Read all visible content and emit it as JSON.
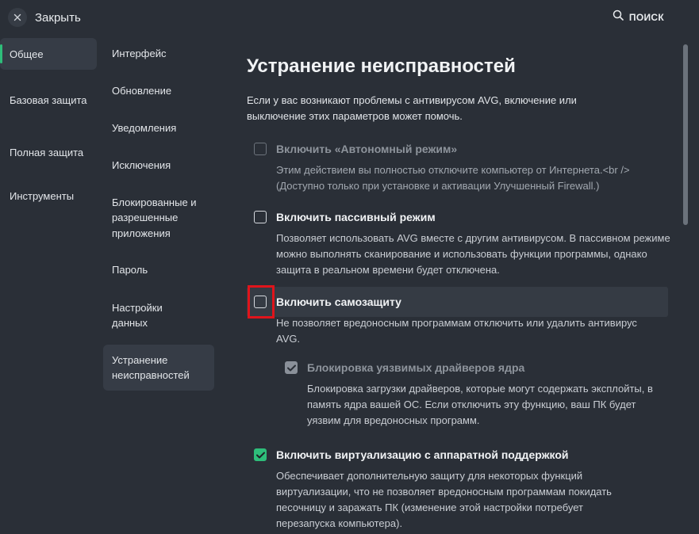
{
  "header": {
    "close_label": "Закрыть",
    "search_label": "ПОИСК"
  },
  "nav_primary": [
    {
      "label": "Общее",
      "active": true
    },
    {
      "label": "Базовая защита",
      "active": false
    },
    {
      "label": "Полная защита",
      "active": false
    },
    {
      "label": "Инструменты",
      "active": false
    }
  ],
  "nav_secondary": [
    {
      "label": "Интерфейс",
      "active": false
    },
    {
      "label": "Обновление",
      "active": false
    },
    {
      "label": "Уведомления",
      "active": false
    },
    {
      "label": "Исключения",
      "active": false
    },
    {
      "label": "Блокированные и разрешенные приложения",
      "active": false
    },
    {
      "label": "Пароль",
      "active": false
    },
    {
      "label": "Настройки данных",
      "active": false
    },
    {
      "label": "Устранение неисправностей",
      "active": true
    }
  ],
  "content": {
    "title": "Устранение неисправностей",
    "intro": "Если у вас возникают проблемы с антивирусом AVG, включение или выключение этих параметров может помочь.",
    "options": [
      {
        "label": "Включить «Автономный режим»",
        "checked": false,
        "disabled": true,
        "description": "Этим действием вы полностью отключите компьютер от Интернета.<br /> (Доступно только при установке и активации Улучшенный Firewall.)"
      },
      {
        "label": "Включить пассивный режим",
        "checked": false,
        "disabled": false,
        "description": "Позволяет использовать AVG вместе с другим антивирусом. В пассивном режиме можно выполнять сканирование и использовать функции программы, однако защита в реальном времени будет отключена."
      },
      {
        "label": "Включить самозащиту",
        "checked": false,
        "disabled": false,
        "description": "Не позволяет вредоносным программам отключить или удалить антивирус AVG."
      },
      {
        "label": "Блокировка уязвимых драйверов ядра",
        "checked": true,
        "disabled": true,
        "description": "Блокировка загрузки драйверов, которые могут содержать эксплойты, в память ядра вашей ОС. Если отключить эту функцию, ваш ПК будет уязвим для вредоносных программ."
      },
      {
        "label": "Включить виртуализацию с аппаратной поддержкой",
        "checked": true,
        "disabled": false,
        "description": "Обеспечивает дополнительную защиту для некоторых функций виртуализации, что не позволяет вредоносным программам покидать песочницу и заражать ПК (изменение этой настройки потребует перезапуска компьютера)."
      }
    ]
  },
  "colors": {
    "background": "#2a2f37",
    "accent": "#2ebd7a",
    "highlight": "#e0141b"
  }
}
